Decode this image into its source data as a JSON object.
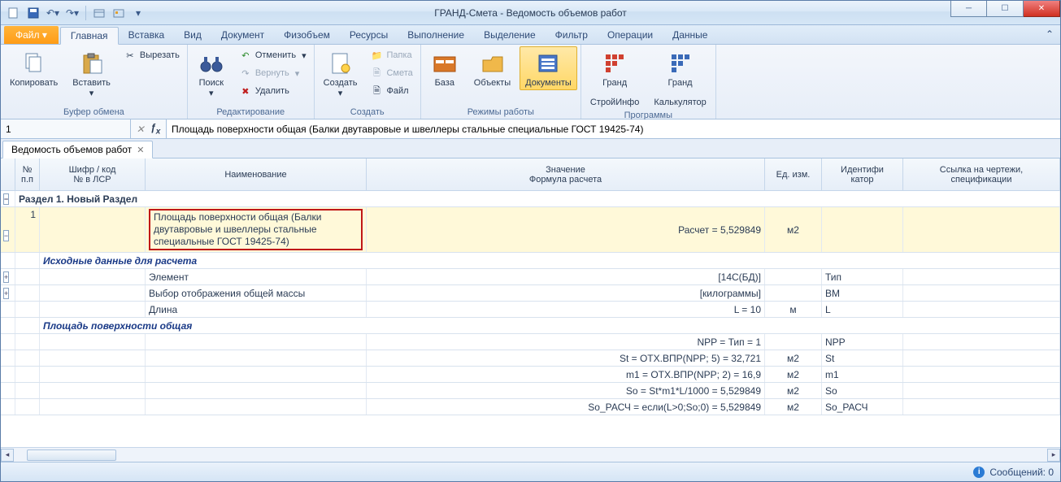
{
  "window": {
    "title": "ГРАНД-Смета - Ведомость объемов работ"
  },
  "tabs": {
    "file": "Файл",
    "items": [
      "Главная",
      "Вставка",
      "Вид",
      "Документ",
      "Физобъем",
      "Ресурсы",
      "Выполнение",
      "Выделение",
      "Фильтр",
      "Операции",
      "Данные"
    ],
    "active_index": 0
  },
  "ribbon": {
    "group1_label": "Буфер обмена",
    "copy": "Копировать",
    "paste": "Вставить",
    "cut": "Вырезать",
    "group2_label": "Редактирование",
    "search": "Поиск",
    "undo": "Отменить",
    "redo": "Вернуть",
    "delete": "Удалить",
    "group3_label": "Создать",
    "create": "Создать",
    "folder": "Папка",
    "smeta": "Смета",
    "file_item": "Файл",
    "group4_label": "Режимы работы",
    "base": "База",
    "objects": "Объекты",
    "documents": "Документы",
    "group5_label": "Программы",
    "prog1_top": "Гранд",
    "prog1_bot": "СтройИнфо",
    "prog2_top": "Гранд",
    "prog2_bot": "Калькулятор"
  },
  "formula": {
    "address": "1",
    "value": "Площадь поверхности общая (Балки двутавровые и швеллеры стальные специальные ГОСТ 19425-74)"
  },
  "doctab": "Ведомость объемов работ",
  "columns": {
    "num": "№\nп.п",
    "code": "Шифр / код\n№ в ЛСР",
    "name": "Наименование",
    "value": "Значение\nФормула расчета",
    "unit": "Ед. изм.",
    "id": "Идентифи\nкатор",
    "ref": "Ссылка на чертежи,\nспецификации"
  },
  "rows": {
    "section": "Раздел 1. Новый Раздел",
    "r1_num": "1",
    "r1_name": "Площадь поверхности общая (Балки двутавровые и швеллеры стальные специальные ГОСТ 19425-74)",
    "r1_value": "Расчет = 5,529849",
    "r1_unit": "м2",
    "sub1": "Исходные данные для расчета",
    "d1_name": "Элемент",
    "d1_value": "[14С(БД)]",
    "d1_id": "Тип",
    "d2_name": "Выбор отображения общей массы",
    "d2_value": "[килограммы]",
    "d2_id": "ВМ",
    "d3_name": "Длина",
    "d3_value": "L = 10",
    "d3_unit": "м",
    "d3_id": "L",
    "sub2": "Площадь поверхности общая",
    "c1_value": "NPP = Тип = 1",
    "c1_id": "NPP",
    "c2_value": "St = ОТХ.ВПР(NPP; 5) = 32,721",
    "c2_unit": "м2",
    "c2_id": "St",
    "c3_value": "m1 = ОТХ.ВПР(NPP; 2) = 16,9",
    "c3_unit": "м2",
    "c3_id": "m1",
    "c4_value": "So = St*m1*L/1000 = 5,529849",
    "c4_unit": "м2",
    "c4_id": "So",
    "c5_value": "So_РАСЧ = если(L>0;So;0) = 5,529849",
    "c5_unit": "м2",
    "c5_id": "So_РАСЧ"
  },
  "status": {
    "messages": "Сообщений: 0"
  }
}
